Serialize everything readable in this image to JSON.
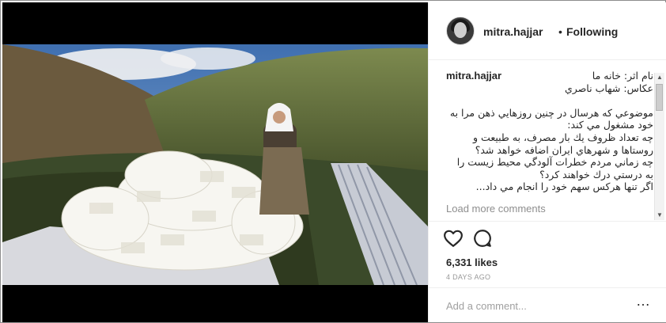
{
  "post": {
    "username": "mitra.hajjar",
    "separator": "•",
    "follow_status": "Following"
  },
  "caption": {
    "username": "mitra.hajjar",
    "text": "نام اثر: خانه ما\nعكاس: شهاب ناصري\n\nموضوعي كه هرسال در چنين روزهايي ذهن مرا به خود مشغول مي كند:\nچه تعداد ظروف يك بار مصرف، به طبيعت و روستاها و شهرهاي ايران اضافه خواهد شد؟\nچه زماني مردم خطرات آلودگي محيط زيست را به درستي درك خواهند كرد؟\nاگر تنها هركس سهم خود را انجام مي داد...",
    "load_more": "Load more comments"
  },
  "stats": {
    "likes": "6,331 likes",
    "time_ago": "4 DAYS AGO"
  },
  "comment_box": {
    "placeholder": "Add a comment..."
  },
  "icons": {
    "like": "heart-icon",
    "comment": "comment-bubble-icon",
    "more": "more-options-icon"
  }
}
